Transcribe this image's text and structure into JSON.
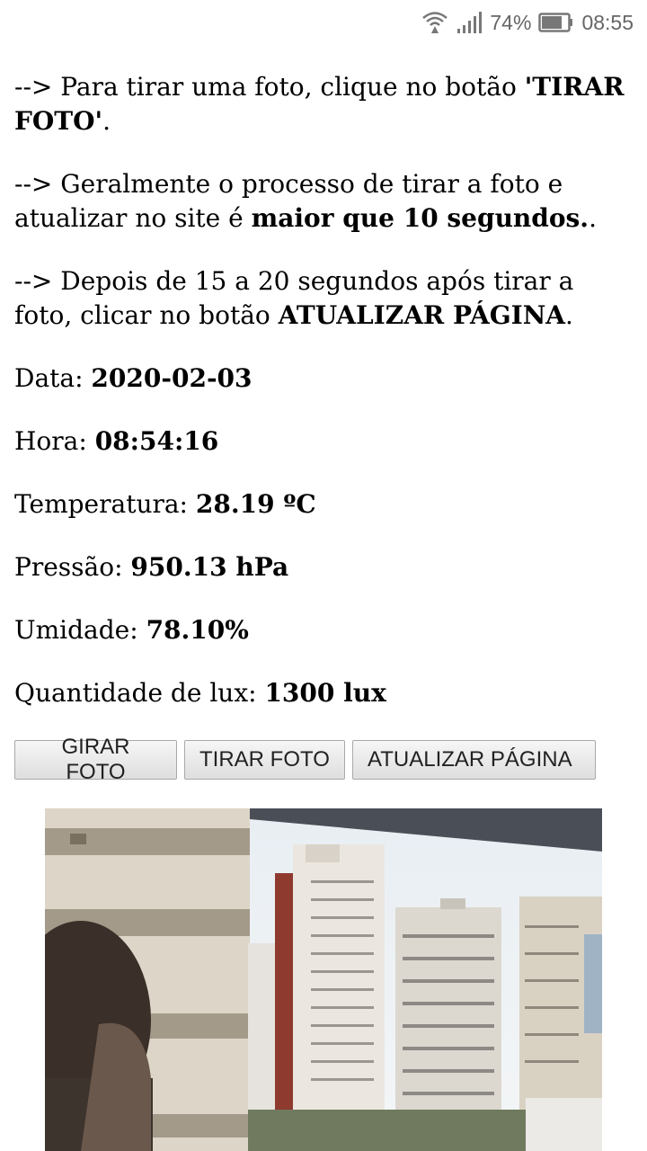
{
  "status_bar": {
    "battery_percent": "74%",
    "time": "08:55",
    "icons": [
      "wifi-icon",
      "signal-icon",
      "battery-icon"
    ]
  },
  "instructions": [
    {
      "arrow": "-->",
      "text": " Para tirar uma foto, clique no botão ",
      "bold": "'TIRAR FOTO'",
      "tail": "."
    },
    {
      "arrow": "-->",
      "text": " Geralmente o processo de tirar a foto e atualizar no site é ",
      "bold": "maior que 10 segundos.",
      "tail": "."
    },
    {
      "arrow": "-->",
      "text": " Depois de 15 a 20 segundos após tirar a foto, clicar no botão ",
      "bold": "ATUALIZAR PÁGINA",
      "tail": "."
    }
  ],
  "readings": {
    "date": {
      "label": "Data: ",
      "value": "2020-02-03"
    },
    "time": {
      "label": "Hora: ",
      "value": "08:54:16"
    },
    "temperature": {
      "label": "Temperatura: ",
      "value": "28.19 ºC"
    },
    "pressure": {
      "label": "Pressão: ",
      "value": "950.13 hPa"
    },
    "humidity": {
      "label": "Umidade: ",
      "value": "78.10%"
    },
    "lux": {
      "label": "Quantidade de lux: ",
      "value": "1300 lux"
    }
  },
  "buttons": {
    "rotate": "GIRAR FOTO",
    "capture": "TIRAR FOTO",
    "refresh": "ATUALIZAR PÁGINA"
  }
}
